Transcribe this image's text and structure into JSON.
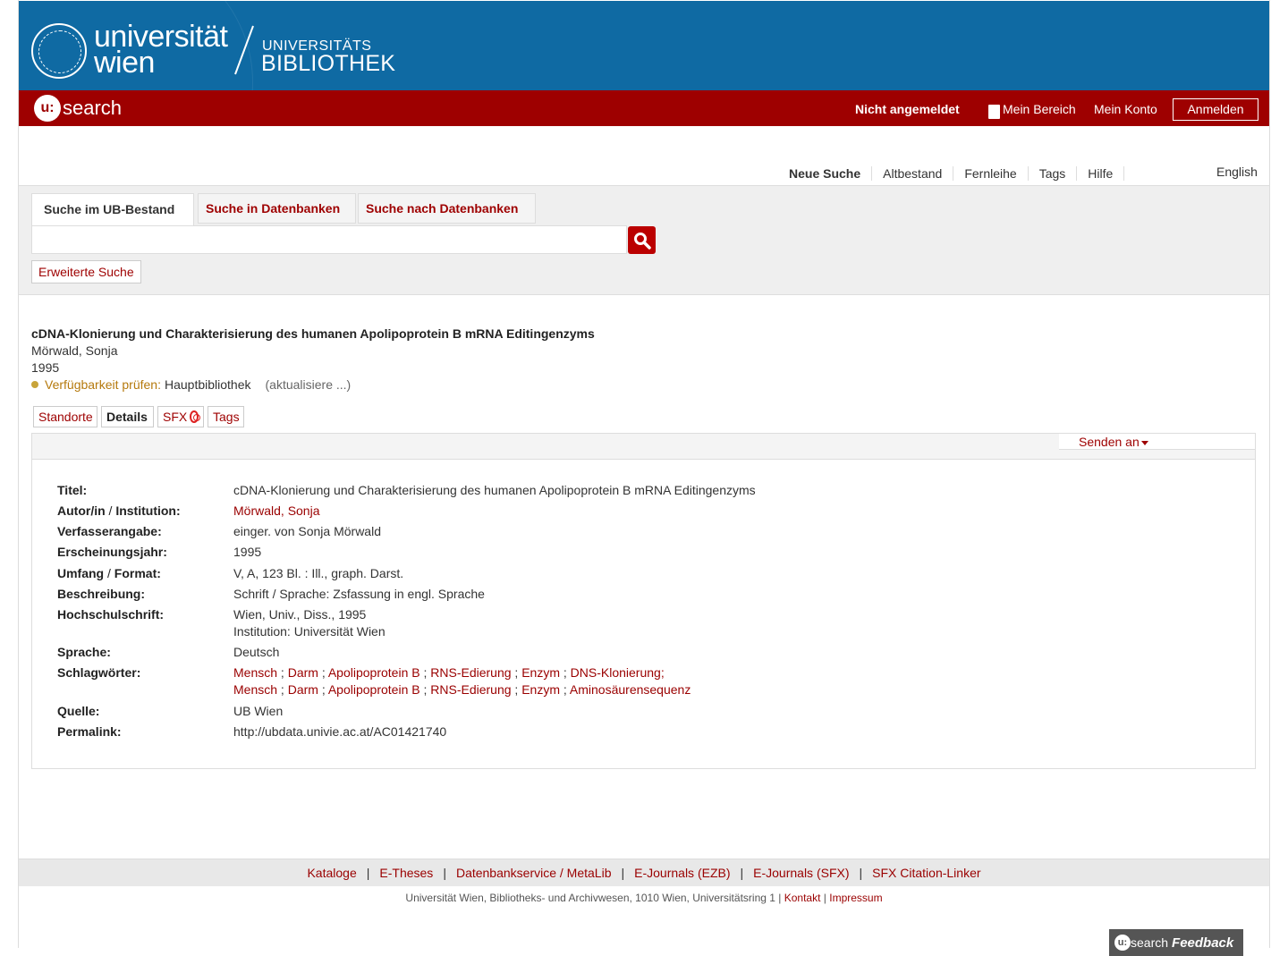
{
  "header": {
    "logo_uni": "universität wien",
    "logo_ub_top": "UNIVERSITÄTS",
    "logo_ub_bottom": "BIBLIOTHEK",
    "usearch_u": "u:",
    "usearch_text": "search",
    "login_status": "Nicht angemeldet",
    "mein_bereich": "Mein Bereich",
    "mein_konto": "Mein Konto",
    "anmelden": "Anmelden"
  },
  "topnav": {
    "items": [
      "Neue Suche",
      "Altbestand",
      "Fernleihe",
      "Tags",
      "Hilfe"
    ],
    "language": "English"
  },
  "search": {
    "tabs": [
      "Suche im UB-Bestand",
      "Suche in Datenbanken",
      "Suche nach Datenbanken"
    ],
    "input_value": "",
    "advanced": "Erweiterte Suche"
  },
  "record": {
    "title": "cDNA-Klonierung und Charakterisierung des humanen Apolipoprotein B mRNA Editingenzyms",
    "author": "Mörwald, Sonja",
    "year": "1995",
    "avail_label": "Verfügbarkeit prüfen:",
    "avail_library": "Hauptbibliothek",
    "avail_status": "(aktualisiere ...)",
    "tabs": [
      "Standorte",
      "Details",
      "SFX",
      "Tags"
    ],
    "send_to": "Senden an"
  },
  "details": {
    "titel_label": "Titel:",
    "titel": "cDNA-Klonierung und Charakterisierung des humanen Apolipoprotein B mRNA Editingenzyms",
    "autor_label_a": "Autor/in",
    "autor_label_sep": " / ",
    "autor_label_b": "Institution:",
    "autor_last": "Mörwald,",
    "autor_first": "Sonja",
    "verfasser_label": "Verfasserangabe:",
    "verfasser": "einger. von Sonja Mörwald",
    "jahr_label": "Erscheinungsjahr:",
    "jahr": "1995",
    "umfang_label_a": "Umfang",
    "umfang_label_sep": " / ",
    "umfang_label_b": "Format:",
    "umfang": "V, A, 123 Bl. : Ill., graph. Darst.",
    "beschreibung_label": "Beschreibung:",
    "beschreibung": "Schrift / Sprache: Zsfassung in engl. Sprache",
    "hochschul_label": "Hochschulschrift:",
    "hochschul_1": "Wien, Univ., Diss., 1995",
    "hochschul_2": "Institution: Universität Wien",
    "sprache_label": "Sprache:",
    "sprache": "Deutsch",
    "schlag_label": "Schlagwörter:",
    "schlag_row1": [
      "Mensch",
      "Darm",
      "Apolipoprotein B",
      "RNS-Edierung",
      "Enzym",
      "DNS-Klonierung;"
    ],
    "schlag_row2": [
      "Mensch",
      "Darm",
      "Apolipoprotein B",
      "RNS-Edierung",
      "Enzym",
      "Aminosäurensequenz"
    ],
    "schlag_sep": ";",
    "quelle_label": "Quelle:",
    "quelle": "UB Wien",
    "permalink_label": "Permalink:",
    "permalink": "http://ubdata.univie.ac.at/AC01421740"
  },
  "footer": {
    "links": [
      "Kataloge",
      "E-Theses",
      "Datenbankservice / MetaLib",
      "E-Journals (EZB)",
      "E-Journals (SFX)",
      "SFX Citation-Linker"
    ],
    "link_sep": "|",
    "address": "Universität Wien, Bibliotheks- und Archivwesen, 1010 Wien, Universitätsring 1",
    "sep": "|",
    "kontakt": "Kontakt",
    "impressum": "Impressum",
    "feedback_u": "u:",
    "feedback_search": "search",
    "feedback_label": "Feedback"
  },
  "colors": {
    "blue": "#0f6aa3",
    "red": "#9e0000",
    "link": "#9a0000"
  }
}
